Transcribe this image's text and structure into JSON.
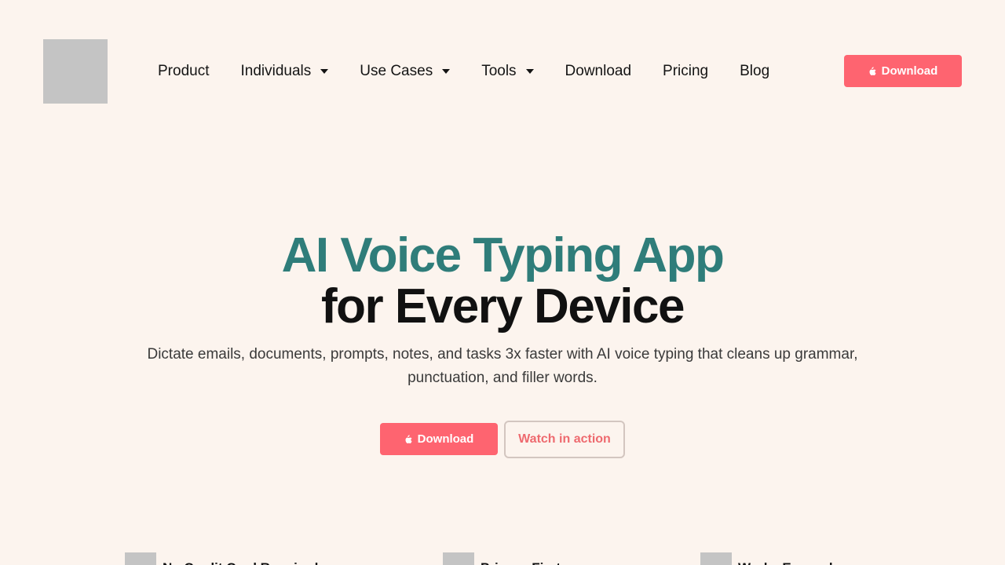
{
  "header": {
    "nav": [
      {
        "label": "Product",
        "has_dropdown": false
      },
      {
        "label": "Individuals",
        "has_dropdown": true
      },
      {
        "label": "Use Cases",
        "has_dropdown": true
      },
      {
        "label": "Tools",
        "has_dropdown": true
      },
      {
        "label": "Download",
        "has_dropdown": false
      },
      {
        "label": "Pricing",
        "has_dropdown": false
      },
      {
        "label": "Blog",
        "has_dropdown": false
      }
    ],
    "download_label": "Download"
  },
  "hero": {
    "title_line1": "AI Voice Typing App",
    "title_line2": "for Every Device",
    "subtitle": "Dictate emails, documents, prompts, notes, and tasks 3x faster with AI voice typing that cleans up grammar, punctuation, and filler words.",
    "primary_label": "Download",
    "secondary_label": "Watch in action"
  },
  "features": [
    {
      "label": "No Credit Card Required"
    },
    {
      "label": "Privacy First"
    },
    {
      "label": "Works Everywhere"
    }
  ],
  "colors": {
    "background": "#fcf4ee",
    "accent": "#fe6470",
    "teal": "#2f7d7a"
  }
}
